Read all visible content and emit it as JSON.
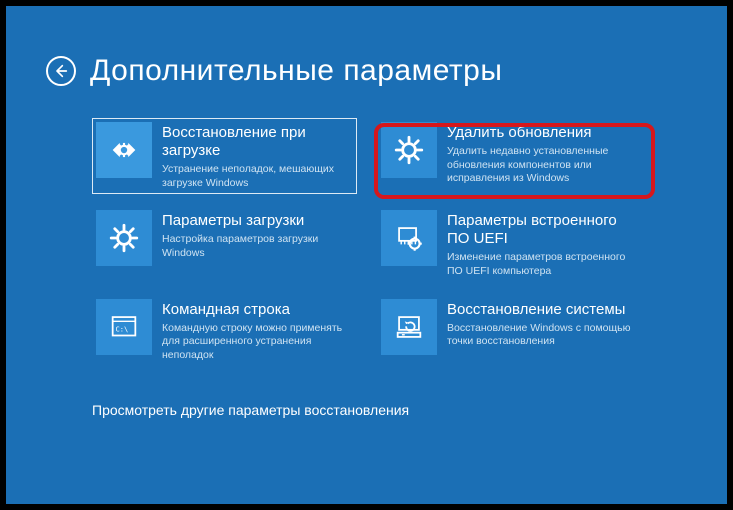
{
  "header": {
    "title": "Дополнительные параметры"
  },
  "tiles": [
    {
      "title": "Восстановление при загрузке",
      "desc": "Устранение неполадок, мешающих загрузке Windows"
    },
    {
      "title": "Удалить обновления",
      "desc": "Удалить недавно установленные обновления компонентов или исправления из Windows"
    },
    {
      "title": "Параметры загрузки",
      "desc": "Настройка параметров загрузки Windows"
    },
    {
      "title": "Параметры встроенного ПО UEFI",
      "desc": "Изменение параметров встроенного ПО UEFI компьютера"
    },
    {
      "title": "Командная строка",
      "desc": "Командную строку можно применять для расширенного устранения неполадок"
    },
    {
      "title": "Восстановление системы",
      "desc": "Восстановление Windows с помощью точки восстановления"
    }
  ],
  "footer": {
    "more": "Просмотреть другие параметры восстановления"
  }
}
